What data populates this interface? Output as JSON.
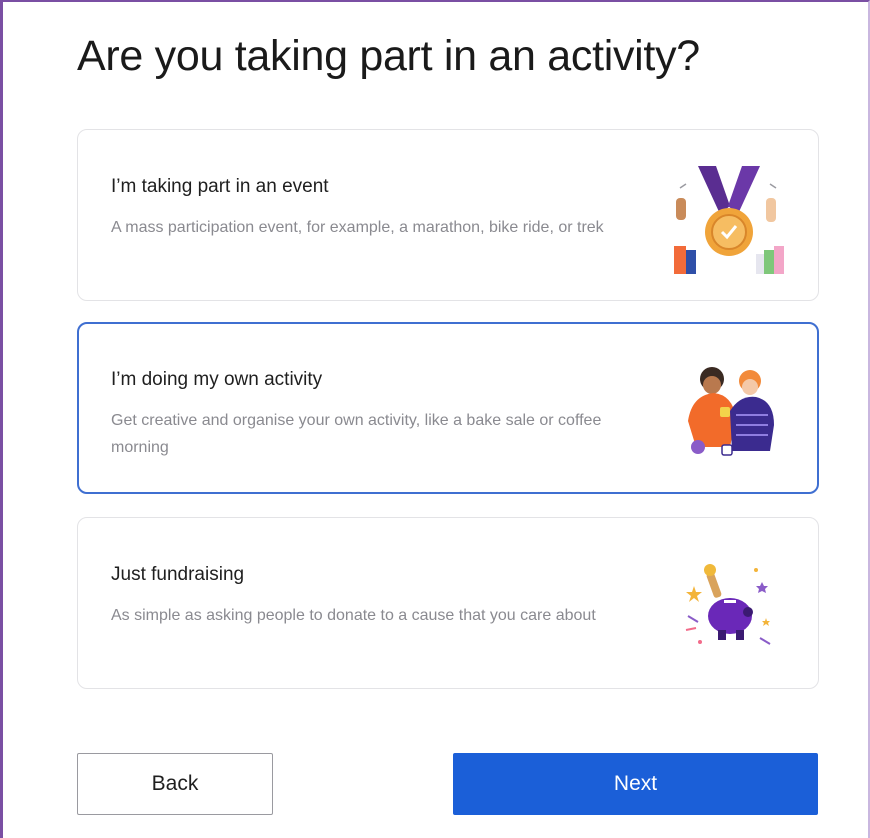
{
  "page": {
    "title": "Are you taking part in an activity?"
  },
  "options": [
    {
      "title": "I’m taking part in an event",
      "description": "A mass participation event, for example, a marathon, bike ride, or trek",
      "icon": "medal-icon",
      "selected": false
    },
    {
      "title": "I’m doing my own activity",
      "description": "Get creative and organise your own activity, like a bake sale or coffee morning",
      "icon": "friends-coffee-icon",
      "selected": true
    },
    {
      "title": "Just fundraising",
      "description": "As simple as asking people to donate to a cause that you care about",
      "icon": "piggy-bank-celebration-icon",
      "selected": false
    }
  ],
  "buttons": {
    "back_label": "Back",
    "next_label": "Next"
  },
  "colors": {
    "primary": "#1b5fd8",
    "selected_border": "#3f6fd1",
    "frame_border": "#7a4fa3"
  }
}
